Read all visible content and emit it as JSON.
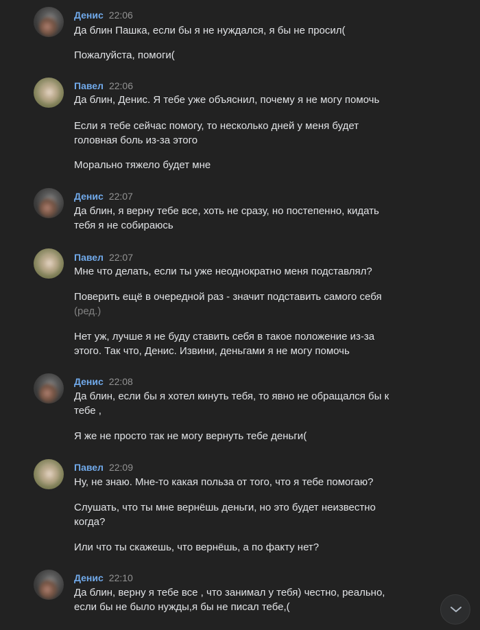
{
  "messages": [
    {
      "author": "Денис",
      "time": "22:06",
      "avatar": "denis",
      "paragraphs": [
        "Да блин Пашка, если бы я не нуждался, я бы не просил(",
        "Пожалуйста, помоги("
      ]
    },
    {
      "author": "Павел",
      "time": "22:06",
      "avatar": "pavel",
      "paragraphs": [
        "Да блин, Денис. Я тебе уже объяснил, почему я не могу помочь",
        "Если я тебе сейчас помогу, то несколько дней у меня будет головная боль из-за этого",
        "Морально тяжело будет мне"
      ]
    },
    {
      "author": "Денис",
      "time": "22:07",
      "avatar": "denis",
      "paragraphs": [
        "Да блин, я верну тебе все, хоть не сразу, но постепенно, кидать тебя я не собираюсь"
      ]
    },
    {
      "author": "Павел",
      "time": "22:07",
      "avatar": "pavel",
      "paragraphs": [
        "Мне что делать, если ты уже неоднократно меня подставлял?",
        "Поверить ещё в очередной раз - значит подставить самого себя",
        "Нет уж, лучше я не буду ставить себя в такое положение из-за этого. Так что, Денис. Извини, деньгами я не могу помочь"
      ],
      "edited_label": "(ред.)"
    },
    {
      "author": "Денис",
      "time": "22:08",
      "avatar": "denis",
      "paragraphs": [
        "Да блин, если бы я хотел кинуть тебя, то явно не обращался бы к тебе ,",
        "Я же не просто так не могу вернуть тебе деньги("
      ]
    },
    {
      "author": "Павел",
      "time": "22:09",
      "avatar": "pavel",
      "paragraphs": [
        "Ну, не знаю. Мне-то какая польза от того, что я тебе помогаю?",
        "Слушать, что ты мне вернёшь деньги, но это будет неизвестно когда?",
        "Или что ты скажешь, что вернёшь, а по факту нет?"
      ]
    },
    {
      "author": "Денис",
      "time": "22:10",
      "avatar": "denis",
      "paragraphs": [
        "Да блин, верну я тебе все , что занимал у тебя) честно, реально, если бы не было нужды,я бы не писал тебе,("
      ]
    }
  ],
  "colors": {
    "background": "#222222",
    "author": "#71aaeb",
    "text": "#e1e3e6",
    "time": "#939393"
  },
  "scroll_button_icon": "chevron-down-icon"
}
